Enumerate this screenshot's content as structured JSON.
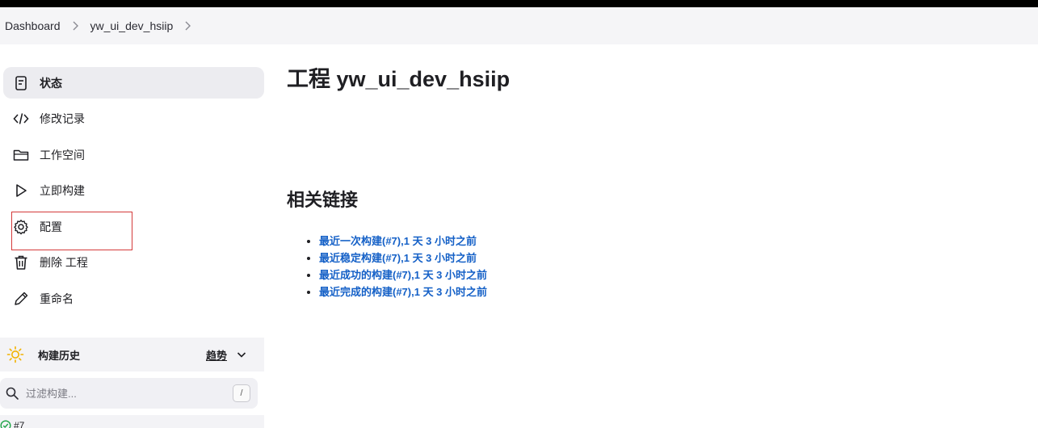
{
  "breadcrumb": {
    "items": [
      "Dashboard",
      "yw_ui_dev_hsiip"
    ]
  },
  "sidebar": {
    "items": [
      {
        "label": "状态",
        "icon": "status-icon",
        "active": true
      },
      {
        "label": "修改记录",
        "icon": "code-icon"
      },
      {
        "label": "工作空间",
        "icon": "folder-icon"
      },
      {
        "label": "立即构建",
        "icon": "play-icon"
      },
      {
        "label": "配置",
        "icon": "gear-icon"
      },
      {
        "label": "删除 工程",
        "icon": "trash-icon"
      },
      {
        "label": "重命名",
        "icon": "pencil-icon"
      }
    ]
  },
  "history": {
    "title": "构建历史",
    "trend": "趋势",
    "filter_placeholder": "过滤构建...",
    "filter_shortcut": "/",
    "first_build": "#7",
    "status_color": "#1ea446",
    "sun_color": "#f2b200"
  },
  "main": {
    "title": "工程 yw_ui_dev_hsiip",
    "related_title": "相关链接",
    "links": [
      "最近一次构建(#7),1 天 3 小时之前",
      "最近稳定构建(#7),1 天 3 小时之前",
      "最近成功的构建(#7),1 天 3 小时之前",
      "最近完成的构建(#7),1 天 3 小时之前"
    ],
    "link_color": "#1460c7"
  },
  "highlight_color": "#d43a3a"
}
